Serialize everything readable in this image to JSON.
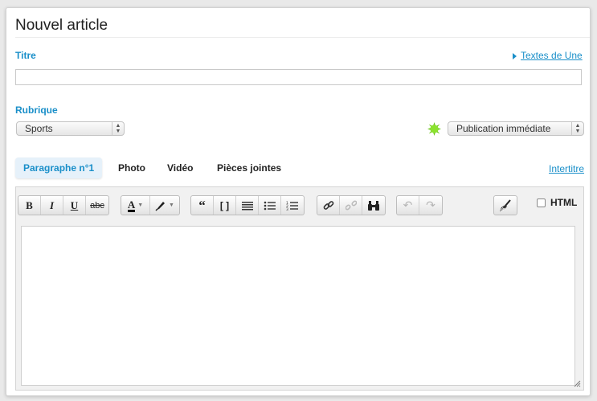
{
  "form": {
    "title": "Nouvel article",
    "titre_label": "Titre",
    "textes_de_une_link": "Textes de Une",
    "titre_value": "",
    "rubrique_label": "Rubrique",
    "rubrique_selected": "Sports",
    "publication_selected": "Publication immédiate",
    "status_color": "#7ed321"
  },
  "tabs": [
    {
      "label": "Paragraphe n°1",
      "active": true
    },
    {
      "label": "Photo",
      "active": false
    },
    {
      "label": "Vidéo",
      "active": false
    },
    {
      "label": "Pièces jointes",
      "active": false
    }
  ],
  "intertitre_link": "Intertitre",
  "toolbar": {
    "bold": "B",
    "italic": "I",
    "underline": "U",
    "strike": "abc",
    "text_color": "A",
    "quote": "“",
    "brackets": "[ ]",
    "html_label": "HTML"
  },
  "editor": {
    "content": ""
  }
}
